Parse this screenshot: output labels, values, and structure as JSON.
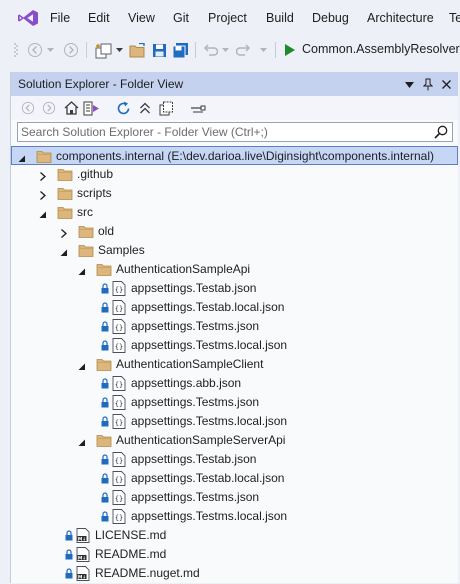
{
  "menu": [
    "File",
    "Edit",
    "View",
    "Git",
    "Project",
    "Build",
    "Debug",
    "Architecture",
    "Te"
  ],
  "toolbar": {
    "run_target": "Common.AssemblyResolver.c"
  },
  "panel": {
    "title": "Solution Explorer - Folder View",
    "search_placeholder": "Search Solution Explorer - Folder View (Ctrl+;)"
  },
  "tree": [
    {
      "label": "components.internal (E:\\dev.darioa.live\\Diginsight\\components.internal)",
      "level": 0,
      "type": "root",
      "expanded": true,
      "selected": true
    },
    {
      "label": ".github",
      "level": 1,
      "type": "folder",
      "expanded": false
    },
    {
      "label": "scripts",
      "level": 1,
      "type": "folder",
      "expanded": false
    },
    {
      "label": "src",
      "level": 1,
      "type": "folder",
      "expanded": true
    },
    {
      "label": "old",
      "level": 2,
      "type": "folder",
      "expanded": false
    },
    {
      "label": "Samples",
      "level": 2,
      "type": "folder",
      "expanded": true
    },
    {
      "label": "AuthenticationSampleApi",
      "level": 3,
      "type": "folder",
      "expanded": true
    },
    {
      "label": "appsettings.Testab.json",
      "level": 4,
      "type": "json"
    },
    {
      "label": "appsettings.Testab.local.json",
      "level": 4,
      "type": "json"
    },
    {
      "label": "appsettings.Testms.json",
      "level": 4,
      "type": "json"
    },
    {
      "label": "appsettings.Testms.local.json",
      "level": 4,
      "type": "json"
    },
    {
      "label": "AuthenticationSampleClient",
      "level": 3,
      "type": "folder",
      "expanded": true
    },
    {
      "label": "appsettings.abb.json",
      "level": 4,
      "type": "json"
    },
    {
      "label": "appsettings.Testms.json",
      "level": 4,
      "type": "json"
    },
    {
      "label": "appsettings.Testms.local.json",
      "level": 4,
      "type": "json"
    },
    {
      "label": "AuthenticationSampleServerApi",
      "level": 3,
      "type": "folder",
      "expanded": true
    },
    {
      "label": "appsettings.Testab.json",
      "level": 4,
      "type": "json"
    },
    {
      "label": "appsettings.Testab.local.json",
      "level": 4,
      "type": "json"
    },
    {
      "label": "appsettings.Testms.json",
      "level": 4,
      "type": "json"
    },
    {
      "label": "appsettings.Testms.local.json",
      "level": 4,
      "type": "json"
    },
    {
      "label": "LICENSE.md",
      "level": 2,
      "type": "md"
    },
    {
      "label": "README.md",
      "level": 2,
      "type": "md"
    },
    {
      "label": "README.nuget.md",
      "level": 2,
      "type": "md"
    }
  ],
  "colors": {
    "accent": "#68217a",
    "title_bar": "#c5d2ef",
    "folder": "#dcb67a",
    "run": "#1e8a2e",
    "selection": "#c5d7f5"
  }
}
